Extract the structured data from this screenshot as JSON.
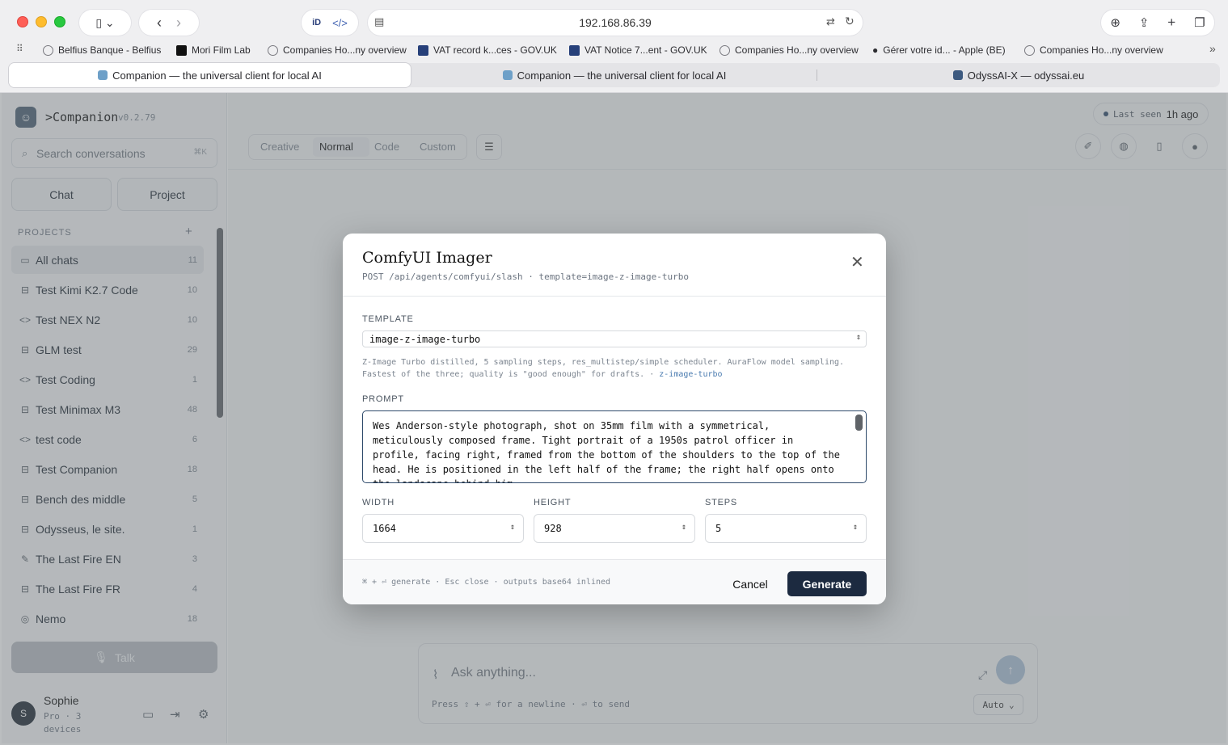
{
  "browser": {
    "address": "192.168.86.39",
    "bookmarks": [
      {
        "label": "Belfius Banque - Belfius",
        "icon": "globe-icon"
      },
      {
        "label": "Mori Film Lab",
        "icon": "mori-logo-icon"
      },
      {
        "label": "Companies Ho...ny overview",
        "icon": "globe-icon"
      },
      {
        "label": "VAT record k...ces - GOV.UK",
        "icon": "govuk-crown-icon"
      },
      {
        "label": "VAT Notice 7...ent - GOV.UK",
        "icon": "govuk-crown-icon"
      },
      {
        "label": "Companies Ho...ny overview",
        "icon": "globe-icon"
      },
      {
        "label": "Gérer votre id... - Apple (BE)",
        "icon": "apple-icon"
      },
      {
        "label": "Companies Ho...ny overview",
        "icon": "globe-icon"
      }
    ],
    "tabs": [
      {
        "label": "Companion — the universal client for local AI",
        "active": true
      },
      {
        "label": "Companion — the universal client for local AI",
        "active": false
      },
      {
        "label": "OdyssAI-X — odyssai.eu",
        "active": false
      }
    ]
  },
  "sidebar": {
    "brand": ">Companion",
    "version": "v0.2.79",
    "search_placeholder": "Search conversations",
    "search_shortcut": "⌘K",
    "chat_label": "Chat",
    "project_label": "Project",
    "projects_heading": "PROJECTS",
    "projects": [
      {
        "name": "All chats",
        "count": "11",
        "icon": "chat-bubble-icon"
      },
      {
        "name": "Test Kimi K2.7 Code",
        "count": "10",
        "icon": "briefcase-icon"
      },
      {
        "name": "Test NEX N2",
        "count": "10",
        "icon": "code-icon"
      },
      {
        "name": "GLM test",
        "count": "29",
        "icon": "briefcase-icon"
      },
      {
        "name": "Test Coding",
        "count": "1",
        "icon": "code-icon"
      },
      {
        "name": "Test Minimax M3",
        "count": "48",
        "icon": "briefcase-icon"
      },
      {
        "name": "test code",
        "count": "6",
        "icon": "code-icon"
      },
      {
        "name": "Test Companion",
        "count": "18",
        "icon": "briefcase-icon"
      },
      {
        "name": "Bench des middle",
        "count": "5",
        "icon": "briefcase-icon"
      },
      {
        "name": "Odysseus, le site.",
        "count": "1",
        "icon": "briefcase-icon"
      },
      {
        "name": "The Last Fire EN",
        "count": "3",
        "icon": "pen-icon"
      },
      {
        "name": "The Last Fire FR",
        "count": "4",
        "icon": "briefcase-icon"
      },
      {
        "name": "Nemo",
        "count": "18",
        "icon": "globe-icon"
      }
    ],
    "talk_label": "Talk",
    "user": {
      "initial": "S",
      "name": "Sophie",
      "plan": "Pro · 3 devices"
    }
  },
  "main": {
    "presets": [
      "Creative",
      "Normal",
      "Code",
      "Custom"
    ],
    "active_preset": "Normal",
    "last_seen_label": "Last seen",
    "last_seen_value": "1h ago",
    "composer_placeholder": "Ask anything...",
    "composer_hint": "Press ⇧ + ⏎ for a newline · ⏎ to send",
    "composer_mode": "Auto"
  },
  "modal": {
    "title": "ComfyUI Imager",
    "subtitle": "POST /api/agents/comfyui/slash · template=image-z-image-turbo",
    "template_label": "TEMPLATE",
    "template_value": "image-z-image-turbo",
    "template_desc": "Z-Image Turbo distilled, 5 sampling steps, res_multistep/simple scheduler. AuraFlow model sampling. Fastest of the three; quality is \"good enough\" for drafts. · ",
    "template_link": "z-image-turbo",
    "prompt_label": "PROMPT",
    "prompt_text": "Wes Anderson-style photograph, shot on 35mm film with a symmetrical,\nmeticulously composed frame. Tight portrait of a 1950s patrol officer in\nprofile, facing right, framed from the bottom of the shoulders to the top of the\nhead. He is positioned in the left half of the frame; the right half opens onto\nthe landscape behind him",
    "width_label": "WIDTH",
    "width_value": "1664",
    "height_label": "HEIGHT",
    "height_value": "928",
    "steps_label": "STEPS",
    "steps_value": "5",
    "footer_hint": "⌘ + ⏎ generate · Esc close · outputs base64 inlined",
    "cancel_label": "Cancel",
    "generate_label": "Generate"
  }
}
